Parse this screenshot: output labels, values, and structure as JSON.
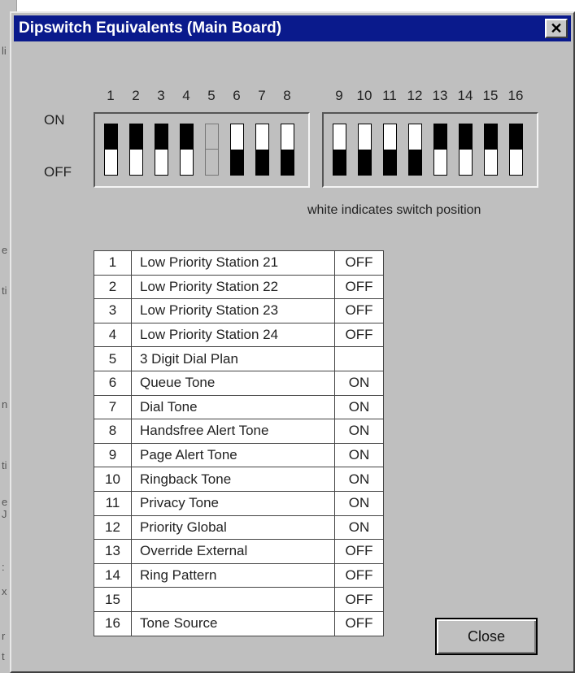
{
  "window": {
    "title": "Dipswitch Equivalents (Main Board)",
    "close_glyph": "✕"
  },
  "switches": {
    "numbers": [
      "1",
      "2",
      "3",
      "4",
      "5",
      "6",
      "7",
      "8",
      "9",
      "10",
      "11",
      "12",
      "13",
      "14",
      "15",
      "16"
    ],
    "on_label": "ON",
    "off_label": "OFF",
    "positions": [
      "OFF",
      "OFF",
      "OFF",
      "OFF",
      "",
      "ON",
      "ON",
      "ON",
      "ON",
      "ON",
      "ON",
      "ON",
      "OFF",
      "OFF",
      "OFF",
      "OFF"
    ],
    "note": "white indicates switch position"
  },
  "table": {
    "rows": [
      {
        "num": "1",
        "function": "Low Priority Station 21",
        "setting": "OFF"
      },
      {
        "num": "2",
        "function": "Low Priority Station 22",
        "setting": "OFF"
      },
      {
        "num": "3",
        "function": "Low Priority Station 23",
        "setting": "OFF"
      },
      {
        "num": "4",
        "function": "Low Priority Station 24",
        "setting": "OFF"
      },
      {
        "num": "5",
        "function": "3 Digit Dial Plan",
        "setting": ""
      },
      {
        "num": "6",
        "function": "Queue Tone",
        "setting": "ON"
      },
      {
        "num": "7",
        "function": "Dial Tone",
        "setting": "ON"
      },
      {
        "num": "8",
        "function": "Handsfree Alert Tone",
        "setting": "ON"
      },
      {
        "num": "9",
        "function": "Page Alert Tone",
        "setting": "ON"
      },
      {
        "num": "10",
        "function": "Ringback Tone",
        "setting": "ON"
      },
      {
        "num": "11",
        "function": "Privacy Tone",
        "setting": "ON"
      },
      {
        "num": "12",
        "function": "Priority Global",
        "setting": "ON"
      },
      {
        "num": "13",
        "function": "Override External",
        "setting": "OFF"
      },
      {
        "num": "14",
        "function": "Ring Pattern",
        "setting": "OFF"
      },
      {
        "num": "15",
        "function": "",
        "setting": "OFF"
      },
      {
        "num": "16",
        "function": "Tone Source",
        "setting": "OFF"
      }
    ]
  },
  "buttons": {
    "close_label": "Close"
  },
  "colors": {
    "titlebar": "#0a1a8c",
    "dialog_bg": "#bfbfbf"
  }
}
